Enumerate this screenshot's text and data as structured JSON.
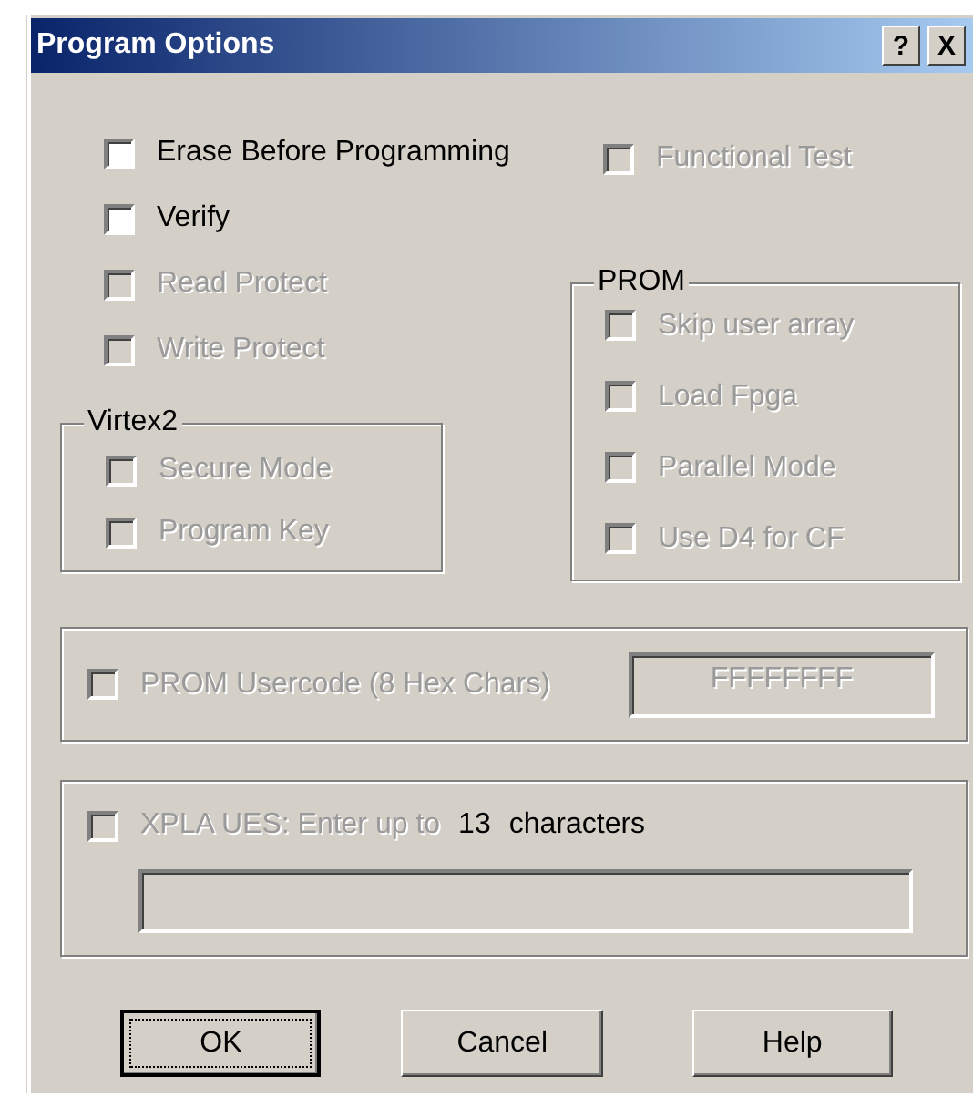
{
  "window": {
    "title": "Program Options",
    "help_button": "?",
    "close_button": "X"
  },
  "options": [
    {
      "label": "Erase Before Programming",
      "checked": false,
      "disabled": false
    },
    {
      "label": "Verify",
      "checked": false,
      "disabled": false
    },
    {
      "label": "Read Protect",
      "checked": false,
      "disabled": true
    },
    {
      "label": "Write Protect",
      "checked": false,
      "disabled": true
    }
  ],
  "functional_test": {
    "label": "Functional Test",
    "checked": false,
    "disabled": true
  },
  "virtex2": {
    "title": "Virtex2",
    "options": [
      {
        "label": "Secure Mode",
        "checked": false,
        "disabled": true
      },
      {
        "label": "Program Key",
        "checked": false,
        "disabled": true
      }
    ]
  },
  "prom": {
    "title": "PROM",
    "options": [
      {
        "label": "Skip user array",
        "checked": false,
        "disabled": true
      },
      {
        "label": "Load Fpga",
        "checked": false,
        "disabled": true
      },
      {
        "label": "Parallel Mode",
        "checked": false,
        "disabled": true
      },
      {
        "label": "Use D4 for CF",
        "checked": false,
        "disabled": true
      }
    ]
  },
  "usercode": {
    "label": "PROM Usercode (8 Hex Chars)",
    "checked": false,
    "disabled": true,
    "value": "FFFFFFFF"
  },
  "xpla_ues": {
    "label": "XPLA UES: Enter up to",
    "count": "13",
    "suffix": "characters",
    "checked": false,
    "disabled": true
  },
  "buttons": [
    {
      "label": "OK",
      "default": true
    },
    {
      "label": "Cancel",
      "default": false
    },
    {
      "label": "Help",
      "default": false
    }
  ]
}
